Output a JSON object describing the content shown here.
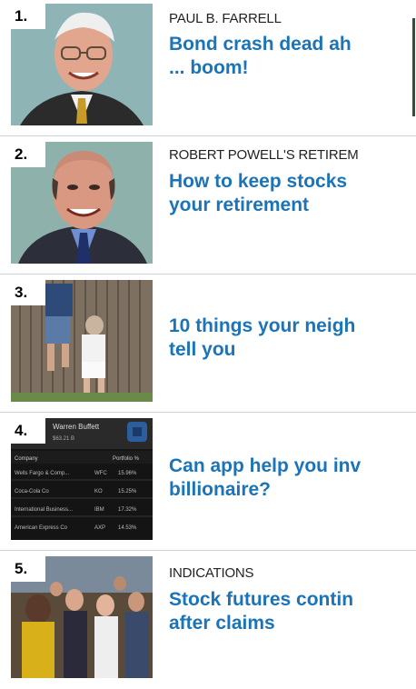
{
  "items": [
    {
      "number": "1.",
      "kicker": "PAUL B. FARRELL",
      "headline_line1": "Bond crash dead ah",
      "headline_line2": "... boom!"
    },
    {
      "number": "2.",
      "kicker": "ROBERT POWELL'S RETIREM",
      "headline_line1": "How to keep stocks",
      "headline_line2": "your retirement"
    },
    {
      "number": "3.",
      "kicker": "",
      "headline_line1": "10 things your neigh",
      "headline_line2": "tell you"
    },
    {
      "number": "4.",
      "kicker": "",
      "headline_line1": "Can app help you inv",
      "headline_line2": "billionaire?"
    },
    {
      "number": "5.",
      "kicker": "INDICATIONS",
      "headline_line1": "Stock futures contin",
      "headline_line2": "after claims"
    }
  ],
  "app_screenshot": {
    "profile_name": "Warren Buffett",
    "profile_value": "$63.21 B",
    "col_company": "Company",
    "col_portfolio": "Portfolio %",
    "rows": [
      {
        "name": "Wells Fargo & Comp...",
        "ticker": "WFC",
        "pct": "15.96%"
      },
      {
        "name": "Coca-Cola Co",
        "ticker": "KO",
        "pct": "15.25%"
      },
      {
        "name": "International Business...",
        "ticker": "IBM",
        "pct": "17.32%"
      },
      {
        "name": "American Express Co",
        "ticker": "AXP",
        "pct": "14.53%"
      }
    ]
  },
  "colors": {
    "headline": "#1b73b8",
    "divider": "#c9d2dc"
  }
}
